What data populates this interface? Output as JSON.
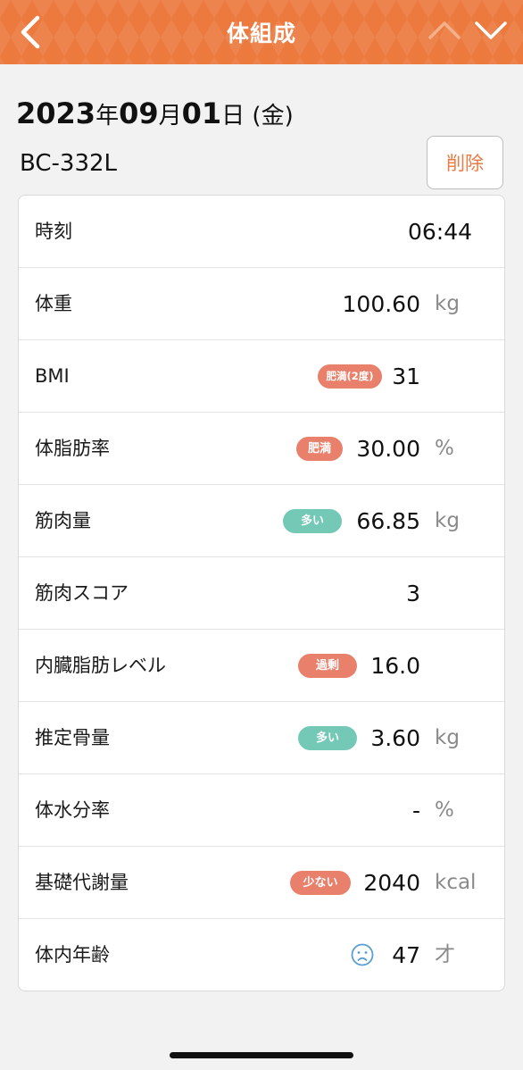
{
  "header": {
    "title": "体組成"
  },
  "date": {
    "year": "2023",
    "year_suffix": "年",
    "month": "09",
    "month_suffix": "月",
    "day": "01",
    "day_suffix": "日",
    "weekday": " (金)"
  },
  "model": "BC-332L",
  "delete_label": "削除",
  "rows": [
    {
      "label": "時刻",
      "value": "06:44",
      "unit": ""
    },
    {
      "label": "体重",
      "value": "100.60",
      "unit": "kg"
    },
    {
      "label": "BMI",
      "value": "31",
      "unit": "",
      "badge": "肥満(2度)",
      "badge_color": "#e8806b"
    },
    {
      "label": "体脂肪率",
      "value": "30.00",
      "unit": "%",
      "badge": "肥満",
      "badge_color": "#e8806b"
    },
    {
      "label": "筋肉量",
      "value": "66.85",
      "unit": "kg",
      "badge": "多い",
      "badge_color": "#73c9b6"
    },
    {
      "label": "筋肉スコア",
      "value": "3",
      "unit": ""
    },
    {
      "label": "内臓脂肪レベル",
      "value": "16.0",
      "unit": "",
      "badge": "過剰",
      "badge_color": "#e8806b"
    },
    {
      "label": "推定骨量",
      "value": "3.60",
      "unit": "kg",
      "badge": "多い",
      "badge_color": "#73c9b6"
    },
    {
      "label": "体水分率",
      "value": "-",
      "unit": "%"
    },
    {
      "label": "基礎代謝量",
      "value": "2040",
      "unit": "kcal",
      "badge": "少ない",
      "badge_color": "#e8806b"
    },
    {
      "label": "体内年齢",
      "value": "47",
      "unit": "才",
      "icon": "sad-face-icon"
    }
  ],
  "colors": {
    "header": "#ec7a3f",
    "accent": "#e87b43",
    "badge_red": "#e8806b",
    "badge_teal": "#73c9b6"
  }
}
